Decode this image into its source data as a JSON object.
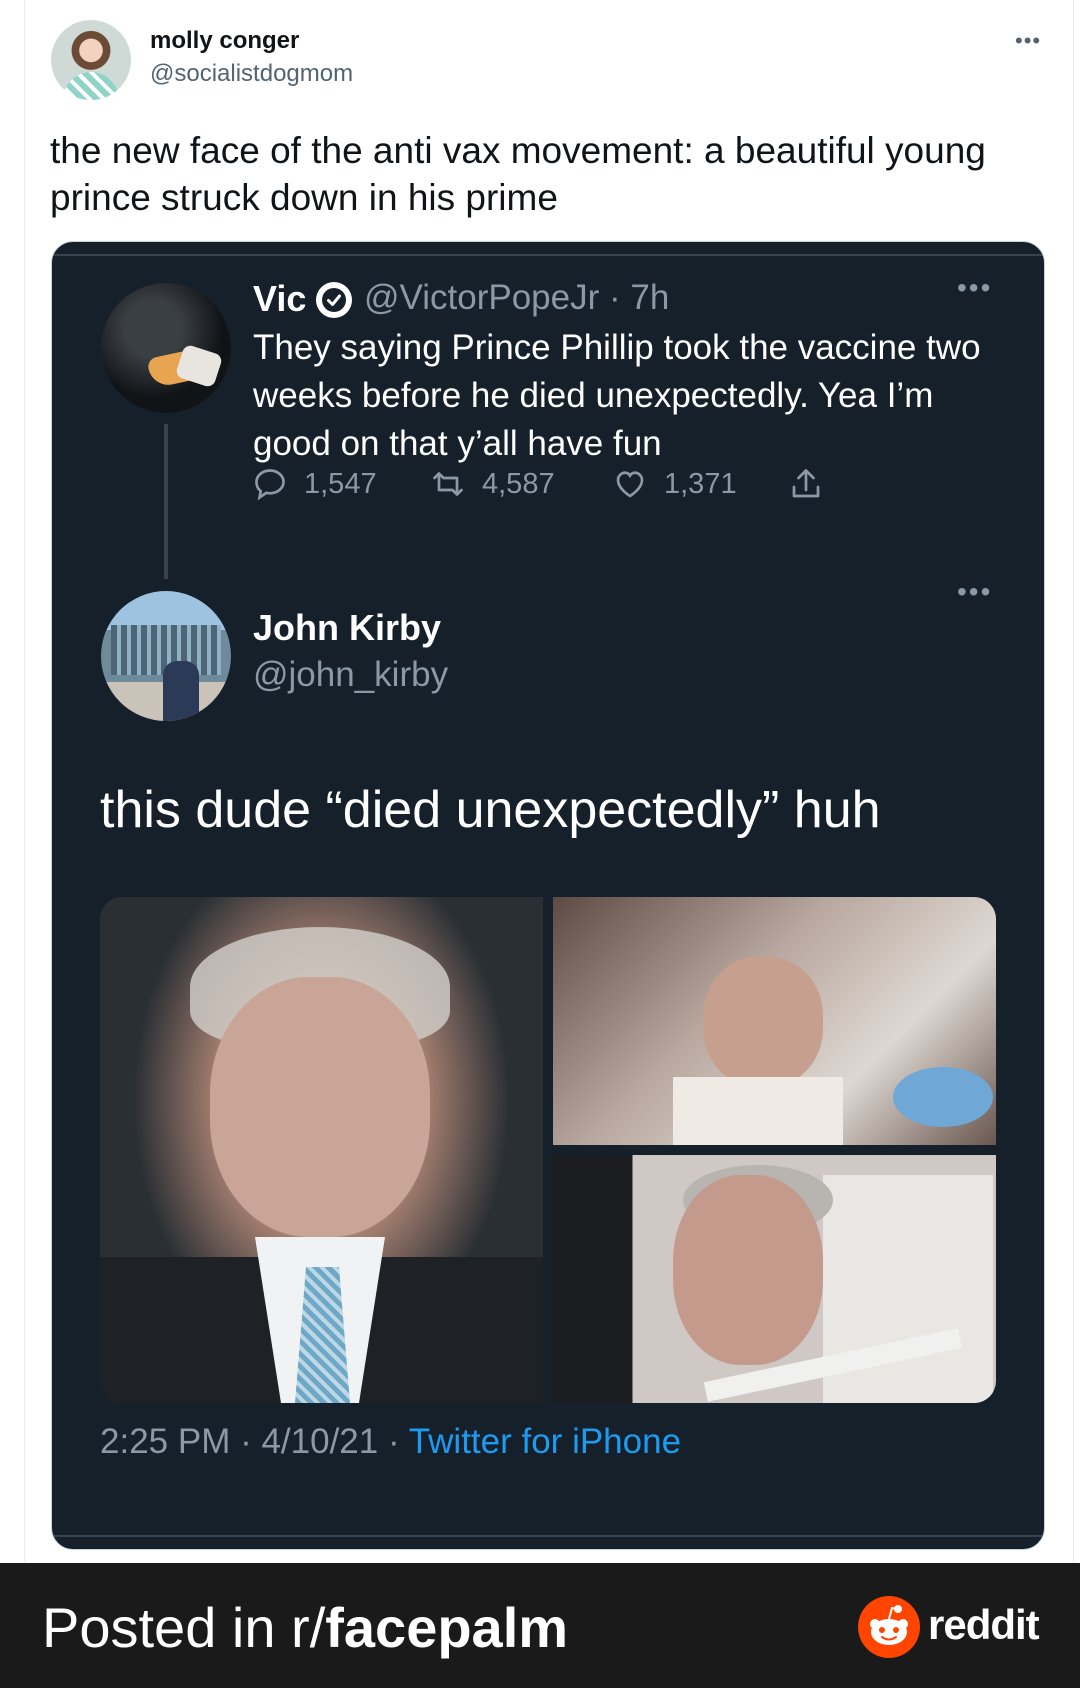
{
  "tweet": {
    "author": {
      "display_name": "molly conger",
      "handle": "@socialistdogmom",
      "avatar_icon": "user-avatar"
    },
    "more_icon": "more-horizontal-icon",
    "text": "the new face of the anti vax movement: a beautiful young prince struck down in his prime"
  },
  "embedded": {
    "reply": {
      "name": "Vic",
      "verified_icon": "verified-badge-icon",
      "handle_time": "@VictorPopeJr · 7h",
      "text": "They saying Prince Phillip took the vaccine two weeks before he died unexpectedly. Yea I’m good on that y’all have fun",
      "actions": {
        "replies": "1,547",
        "retweets": "4,587",
        "likes": "1,371"
      }
    },
    "main": {
      "name": "John Kirby",
      "handle": "@john_kirby",
      "text": "this dude “died unexpectedly” huh",
      "timestamp": "2:25 PM · 4/10/21 · ",
      "source": "Twitter for iPhone"
    },
    "photo_count": 3
  },
  "footer": {
    "posted_prefix": "Posted in r/",
    "subreddit": "facepalm",
    "brand": "reddit"
  },
  "colors": {
    "embed_bg": "#15202b",
    "link_blue": "#1d9bf0",
    "reddit_orange": "#ff4500",
    "footer_bg": "#1a1a1b"
  }
}
